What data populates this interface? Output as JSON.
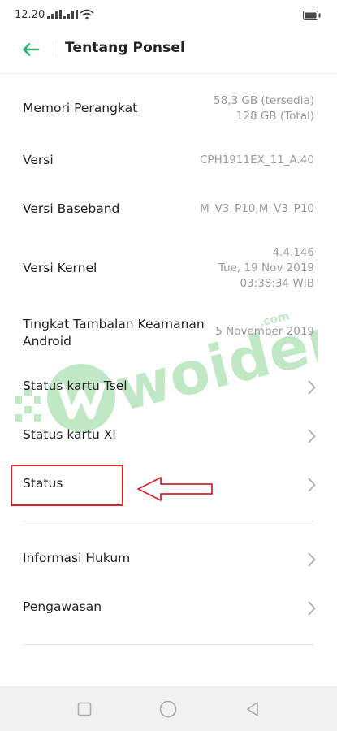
{
  "status_bar": {
    "time": "12.20",
    "icons": [
      "signal-icon",
      "signal-icon",
      "wifi-icon",
      "battery-icon"
    ]
  },
  "header": {
    "title": "Tentang Ponsel",
    "back_icon": "arrow-left-icon",
    "accent": "#2bb673"
  },
  "rows": [
    {
      "label": "Memori Perangkat",
      "value": "58,3 GB (tersedia)\n128 GB (Total)"
    },
    {
      "label": "Versi",
      "value": "CPH1911EX_11_A.40"
    },
    {
      "label": "Versi Baseband",
      "value": "M_V3_P10,M_V3_P10"
    },
    {
      "label": "Versi Kernel",
      "value": "4.4.146\nTue, 19 Nov 2019\n03:38:34 WIB"
    },
    {
      "label": "Tingkat Tambalan Keamanan\nAndroid",
      "value": "5 November 2019"
    },
    {
      "label": "Status kartu Tsel",
      "icon": "chevron-right-icon"
    },
    {
      "label": "Status kartu Xl",
      "icon": "chevron-right-icon"
    },
    {
      "label": "Status",
      "icon": "chevron-right-icon"
    },
    {
      "label": "Informasi Hukum",
      "icon": "chevron-right-icon"
    },
    {
      "label": "Pengawasan",
      "icon": "chevron-right-icon"
    }
  ],
  "annotation": {
    "highlight_color": "#d9232b",
    "arrow_direction": "left"
  },
  "watermark": {
    "text": "woiden",
    "suffix": ".com",
    "color": "#8fd694"
  },
  "nav_bar": {
    "buttons": [
      "recents-square-icon",
      "home-circle-icon",
      "back-triangle-icon"
    ]
  }
}
